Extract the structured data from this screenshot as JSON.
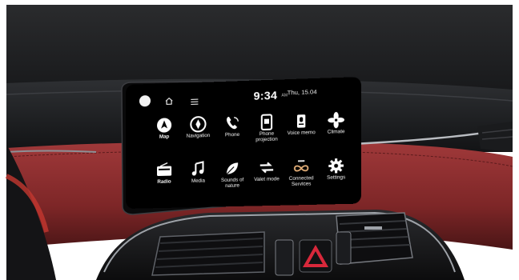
{
  "status_bar": {
    "time": "9:34",
    "ampm": "AM",
    "date": "Thu, 15.04",
    "icons": [
      "profile-icon",
      "home-icon",
      "menu-icon"
    ]
  },
  "apps": [
    {
      "label": "Map",
      "icon": "map-icon"
    },
    {
      "label": "Navigation",
      "icon": "compass-icon"
    },
    {
      "label": "Phone",
      "icon": "phone-icon"
    },
    {
      "label": "Phone\nprojection",
      "icon": "phone-projection-icon"
    },
    {
      "label": "Voice memo",
      "icon": "voice-memo-icon"
    },
    {
      "label": "Climate",
      "icon": "fan-icon"
    },
    {
      "label": "Radio",
      "icon": "radio-icon"
    },
    {
      "label": "Media",
      "icon": "music-note-icon"
    },
    {
      "label": "Sounds of\nnature",
      "icon": "leaf-icon"
    },
    {
      "label": "Valet mode",
      "icon": "valet-icon"
    },
    {
      "label": "Connected\nServices",
      "icon": "connected-services-icon"
    },
    {
      "label": "Settings",
      "icon": "gear-icon"
    }
  ],
  "colors": {
    "screen_bg": "#000000",
    "leather": "#8e2f2f",
    "dash": "#1c1d20",
    "hazard": "#d8283b"
  }
}
